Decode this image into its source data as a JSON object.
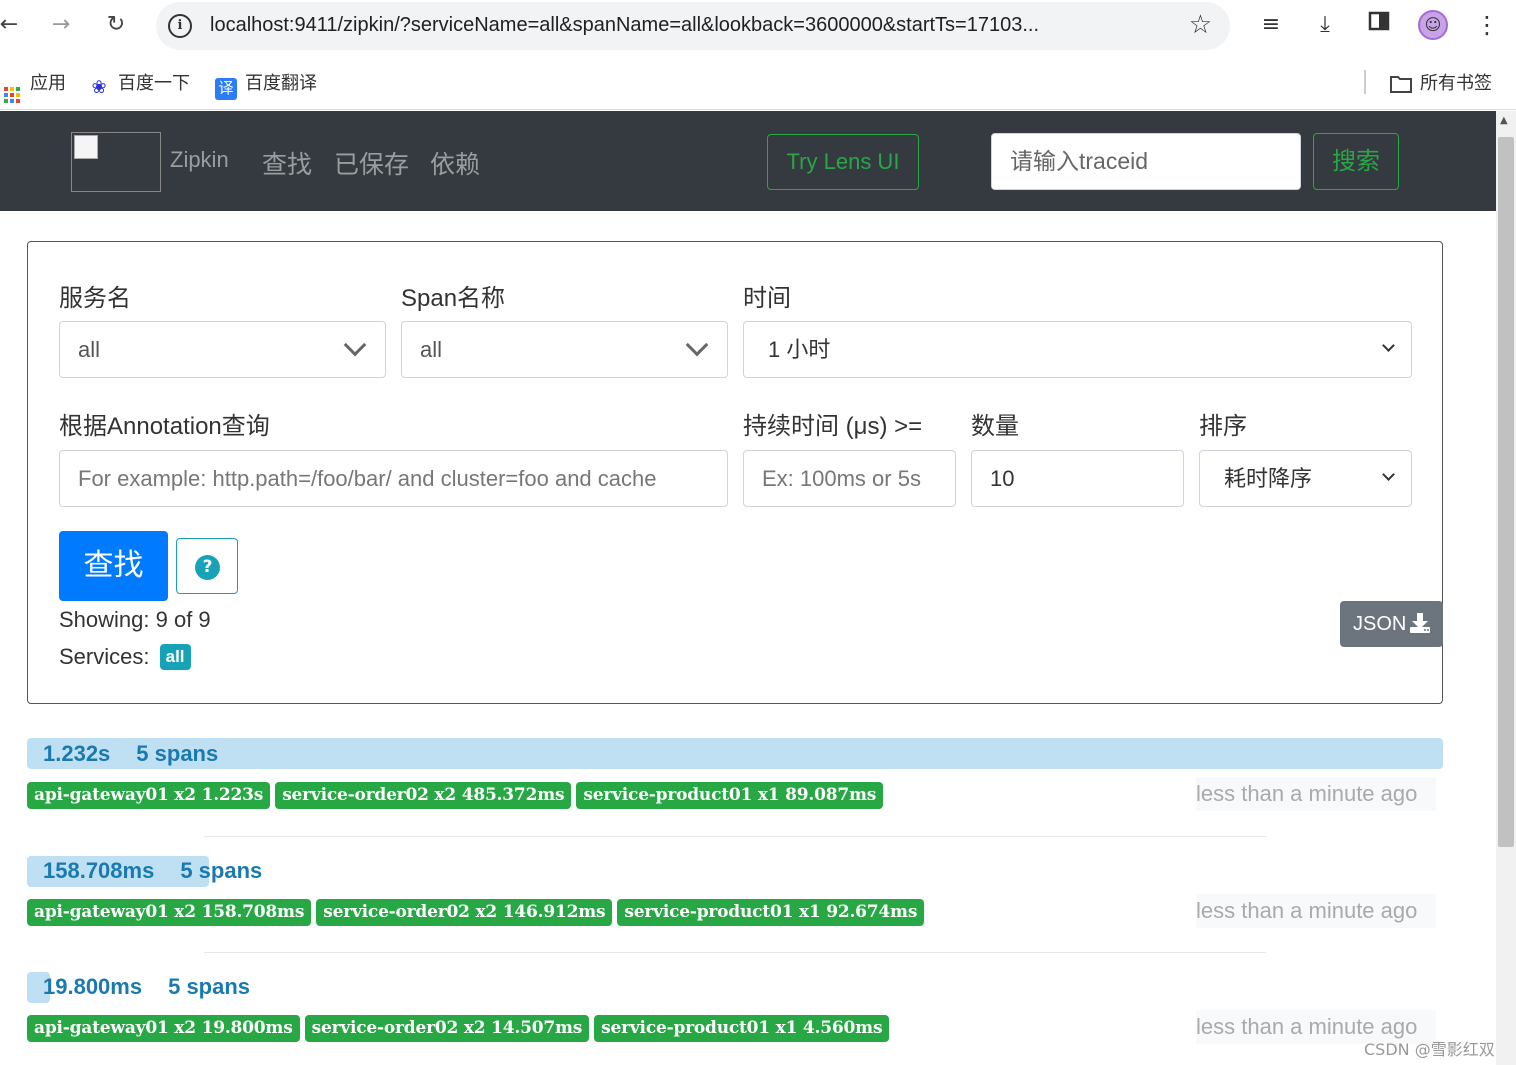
{
  "browser": {
    "url": "localhost:9411/zipkin/?serviceName=all&spanName=all&lookback=3600000&startTs=17103...",
    "bookmarks": [
      "应用",
      "百度一下",
      "百度翻译"
    ],
    "all_bookmarks": "所有书签"
  },
  "navbar": {
    "brand": "Zipkin",
    "links": [
      "查找",
      "已保存",
      "依赖"
    ],
    "lens_button": "Try Lens UI",
    "traceid_placeholder": "请输入traceid",
    "search_button": "搜索"
  },
  "form": {
    "service_label": "服务名",
    "service_value": "all",
    "span_label": "Span名称",
    "span_value": "all",
    "time_label": "时间",
    "time_value": "1 小时",
    "annotation_label": "根据Annotation查询",
    "annotation_placeholder": "For example: http.path=/foo/bar/ and cluster=foo and cache",
    "duration_label": "持续时间 (μs) >=",
    "duration_placeholder": "Ex: 100ms or 5s",
    "limit_label": "数量",
    "limit_value": "10",
    "sort_label": "排序",
    "sort_value": "耗时降序",
    "find_button": "查找",
    "showing": "Showing: 9 of 9",
    "services_label": "Services:",
    "services_badge": "all",
    "json_button": "JSON"
  },
  "results": [
    {
      "duration": "1.232s",
      "spans": "5 spans",
      "bar_fraction": 1.0,
      "tags": [
        "api-gateway01 x2 1.223s",
        "service-order02 x2 485.372ms",
        "service-product01 x1 89.087ms"
      ],
      "time_ago": "less than a minute ago"
    },
    {
      "duration": "158.708ms",
      "spans": "5 spans",
      "bar_fraction": 0.1288,
      "tags": [
        "api-gateway01 x2 158.708ms",
        "service-order02 x2 146.912ms",
        "service-product01 x1 92.674ms"
      ],
      "time_ago": "less than a minute ago"
    },
    {
      "duration": "19.800ms",
      "spans": "5 spans",
      "bar_fraction": 0.0161,
      "tags": [
        "api-gateway01 x2 19.800ms",
        "service-order02 x2 14.507ms",
        "service-product01 x1 4.560ms"
      ],
      "time_ago": "less than a minute ago"
    }
  ],
  "watermark": "CSDN @雪影红双"
}
